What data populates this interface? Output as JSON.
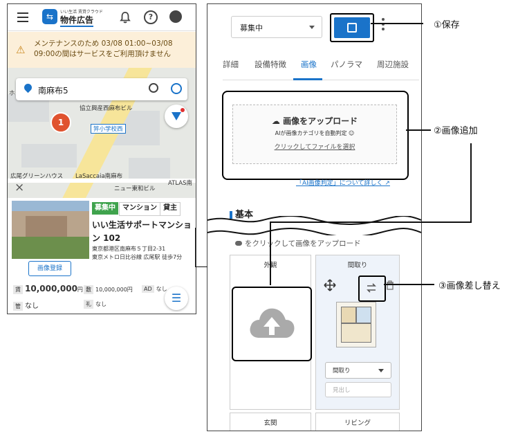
{
  "left_screen": {
    "brand_sub": "いい生活 賃貸クラウド",
    "brand": "物件広告",
    "help_glyph": "?",
    "notice": "メンテナンスのため 03/08 01:00~03/08 09:00の間はサービスをご利用頂けません",
    "search_value": "南麻布5",
    "map_labels": [
      "協立興産西麻布ビル",
      "広尾グリーンハウス",
      "LaSaccaia南麻布",
      "ニュー東和ビル",
      "ATLAS南",
      "ホ"
    ],
    "school_label": "笄小学校西",
    "cluster_count": "1",
    "close_glyph": "×",
    "card": {
      "tags": [
        "募集中",
        "マンション",
        "貸主"
      ],
      "name": "いい生活サポートマンション 102",
      "address": "東京都港区南麻布５丁目2-31",
      "station": "東京メトロ日比谷線 広尾駅 徒歩7分",
      "register_button": "画像登録",
      "rent_label": "賃",
      "rent_value": "10,000,000",
      "rent_unit": "円",
      "deposit_label": "敷",
      "deposit_value": "10,000,000円",
      "ad_label": "AD",
      "ad_value": "なし",
      "mgmt_label": "管",
      "mgmt_value": "なし",
      "key_label": "礼",
      "key_value": "なし"
    }
  },
  "right_screen": {
    "status_select": "募集中",
    "tabs": [
      "詳細",
      "設備特徴",
      "画像",
      "パノラマ",
      "周辺施設"
    ],
    "active_tab": "画像",
    "upload_title": "画像をアップロード",
    "upload_sub": "AIが画像カテゴリを自動判定",
    "upload_link": "クリックしてファイルを選択",
    "ai_link": "「AI画像判定」について詳しく",
    "section_title": "基本",
    "hint": "をクリックして画像をアップロード",
    "slots": [
      {
        "label": "外観"
      },
      {
        "label": "間取り"
      },
      {
        "label": "玄関"
      },
      {
        "label": "リビング"
      }
    ],
    "category_select": "間取り",
    "caption_placeholder": "見出し"
  },
  "annotations": {
    "save": "①保存",
    "add": "②画像追加",
    "replace": "③画像差し替え"
  },
  "colors": {
    "accent": "#1a73c9",
    "status_green": "#3fa34d",
    "notice_bg": "#fcefd9",
    "cluster_red": "#e0532f"
  }
}
